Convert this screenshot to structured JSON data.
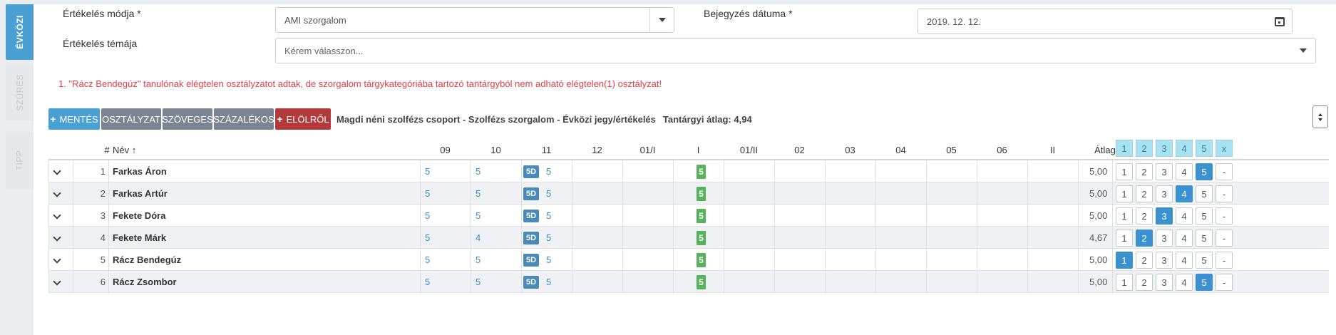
{
  "sidebar": {
    "tabs": [
      {
        "label": "ÉVKÖZI",
        "active": true
      },
      {
        "label": "SZŰRÉS",
        "active": false
      },
      {
        "label": "TIPP",
        "active": false
      }
    ]
  },
  "form": {
    "method_label": "Értékelés módja *",
    "method_value": "AMI szorgalom",
    "date_label": "Bejegyzés dátuma *",
    "date_value": "2019. 12. 12.",
    "topic_label": "Értékelés témája",
    "topic_placeholder": "Kérem válasszon..."
  },
  "error": "1. \"Rácz Bendegúz\" tanulónak elégtelen osztályzatot adtak, de szorgalom tárgykategóriába tartozó tantárgyból nem adható elégtelen(1) osztályzat!",
  "toolbar": {
    "save": "MENTÉS",
    "grade": "OSZTÁLYZAT",
    "text": "SZÖVEGES",
    "percent": "SZÁZALÉKOS",
    "reset": "ELÖLRŐL",
    "info": "Magdi néni szolfézs csoport - Szolfézs szorgalom - Évközi jegy/értékelés",
    "avg_label": "Tantárgyi átlag:",
    "avg_value": "4,94"
  },
  "table": {
    "headers": {
      "num": "#",
      "name": "Név",
      "sort_icon": "↑",
      "months": [
        "09",
        "10",
        "11",
        "12",
        "01/I",
        "I",
        "01/II",
        "02",
        "03",
        "04",
        "05",
        "06",
        "II"
      ],
      "avg": "Átlag",
      "grade_boxes": [
        "1",
        "2",
        "3",
        "4",
        "5",
        "x"
      ]
    },
    "rows": [
      {
        "num": "1",
        "name": "Farkas Áron",
        "g09": "5",
        "g10": "5",
        "b11": "5D",
        "g11": "5",
        "semI": "5",
        "avg": "5,00",
        "selected": 5
      },
      {
        "num": "2",
        "name": "Farkas Artúr",
        "g09": "5",
        "g10": "5",
        "b11": "5D",
        "g11": "5",
        "semI": "5",
        "avg": "5,00",
        "selected": 4
      },
      {
        "num": "3",
        "name": "Fekete Dóra",
        "g09": "5",
        "g10": "5",
        "b11": "5D",
        "g11": "5",
        "semI": "5",
        "avg": "5,00",
        "selected": 3
      },
      {
        "num": "4",
        "name": "Fekete Márk",
        "g09": "5",
        "g10": "4",
        "b11": "5D",
        "g11": "5",
        "semI": "5",
        "avg": "4,67",
        "selected": 2
      },
      {
        "num": "5",
        "name": "Rácz Bendegúz",
        "g09": "5",
        "g10": "5",
        "b11": "5D",
        "g11": "5",
        "semI": "5",
        "avg": "5,00",
        "selected": 1
      },
      {
        "num": "6",
        "name": "Rácz Zsombor",
        "g09": "5",
        "g10": "5",
        "b11": "5D",
        "g11": "5",
        "semI": "5",
        "avg": "5,00",
        "selected": 5
      }
    ],
    "row_buttons": [
      "1",
      "2",
      "3",
      "4",
      "5",
      "-"
    ]
  },
  "colors": {
    "accent": "#4a9fd3",
    "error": "#e2404a",
    "semester_badge": "#56b25b",
    "reset_button": "#b23a3a"
  }
}
